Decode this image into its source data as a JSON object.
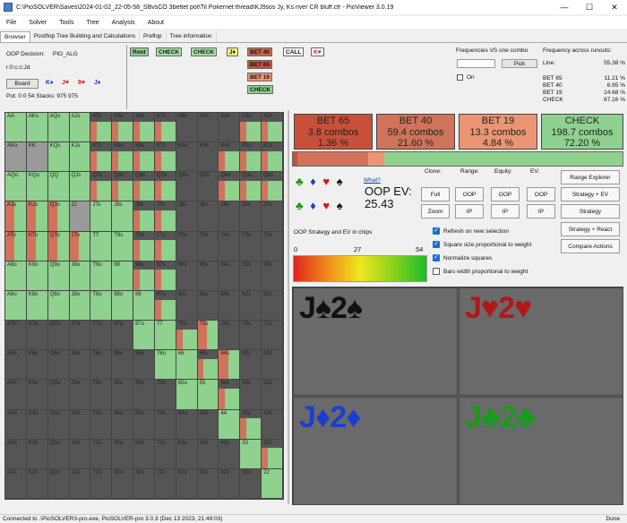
{
  "window": {
    "title": "C:\\PioSOLVER\\Saves\\2024-01-02_22-05-58_SBvsCO 3bettet pot\\Til Pokernet thread\\KJ9sos Jy, Ks river CR bluff.cfr - PioViewer 3.0.19",
    "min_glyph": "—",
    "max_glyph": "☐",
    "close_glyph": "✕"
  },
  "menu": [
    "File",
    "Solver",
    "Tools",
    "Tree",
    "Analysis",
    "About"
  ],
  "tabs": [
    "Browser",
    "Postflop Tree Building and Calculations",
    "Preflop",
    "Tree information"
  ],
  "active_tab": 0,
  "decision": {
    "label": "OOP Decision:",
    "value": "PIO_ALG",
    "board_code": "r:0:c:c:Jd",
    "board_button": "Board",
    "cards": [
      {
        "text": "K♦",
        "color": "#1a3fcf"
      },
      {
        "text": "J♥",
        "color": "#d01818"
      },
      {
        "text": "9♥",
        "color": "#d01818"
      },
      {
        "text": "J♦",
        "color": "#1a3fcf"
      }
    ],
    "pot_text": "Pot: 0 0 54 Stacks: 975 975"
  },
  "tree_nodes": [
    {
      "label": "Root",
      "bg": "#8fd18f"
    },
    {
      "label": "CHECK",
      "bg": "#a5e0a5"
    },
    {
      "label": "CHECK",
      "bg": "#a5e0a5"
    },
    {
      "label": "J♦",
      "bg": "#f5f07a"
    },
    {
      "label": "BET 40",
      "bg": "#c86a4e"
    },
    {
      "label": "CALL",
      "bg": "#ffffff"
    },
    {
      "label": "K♥",
      "bg": "#ffffff"
    },
    {
      "label": "BET 65",
      "bg": "#c8503a"
    },
    {
      "label": "BET 19",
      "bg": "#eb9575"
    },
    {
      "label": "CHECK",
      "bg": "#8fd18f"
    }
  ],
  "freq_combo": {
    "title": "Frequencies VS one combo",
    "pick": "Pick",
    "on_label": "On"
  },
  "runouts": {
    "title": "Frequency across runouts:",
    "line_label": "Line:",
    "line_value": "55.38 %",
    "rows": [
      {
        "label": "BET 65",
        "value": "11.21 %"
      },
      {
        "label": "BET 40",
        "value": "6.95 %"
      },
      {
        "label": "BET 19",
        "value": "14.68 %"
      },
      {
        "label": "CHECK",
        "value": "67.16 %"
      }
    ]
  },
  "actions": [
    {
      "name": "BET 65",
      "combos": "3.8 combos",
      "pct": "1.36 %",
      "color": "#c8503a",
      "share": 1.36
    },
    {
      "name": "BET 40",
      "combos": "59.4 combos",
      "pct": "21.60 %",
      "color": "#d0735a",
      "share": 21.6
    },
    {
      "name": "BET 19",
      "combos": "13.3 combos",
      "pct": "4.84 %",
      "color": "#eb9575",
      "share": 4.84
    },
    {
      "name": "CHECK",
      "combos": "198.7 combos",
      "pct": "72.20 %",
      "color": "#8fd18f",
      "share": 72.2
    }
  ],
  "suits_top": [
    {
      "s": "♣",
      "c": "#1a9a1a"
    },
    {
      "s": "♦",
      "c": "#1a3fcf"
    },
    {
      "s": "♥",
      "c": "#d01818"
    },
    {
      "s": "♠",
      "c": "#111111"
    }
  ],
  "suits_bottom": [
    {
      "s": "♣",
      "c": "#1a9a1a"
    },
    {
      "s": "♦",
      "c": "#1a3fcf"
    },
    {
      "s": "♥",
      "c": "#d01818"
    },
    {
      "s": "♠",
      "c": "#111111"
    }
  ],
  "ev": {
    "what": "What?",
    "label": "OOP EV:",
    "value": "25.43"
  },
  "headers": {
    "clone": "Clone:",
    "range": "Range:",
    "equity": "Equity:",
    "ev": "EV:"
  },
  "buttons": {
    "full": "Full",
    "zoom": "Zoom",
    "range_oop": "OOP",
    "range_ip": "IP",
    "equity_oop": "OOP",
    "equity_ip": "IP",
    "ev_oop": "OOP",
    "ev_ip": "IP",
    "range_explorer": "Range Explorer",
    "strategy_ev": "Strategy + EV",
    "strategy": "Strategy",
    "strategy_react": "Strategy + React",
    "compare_actions": "Compare Actions"
  },
  "chips": {
    "label": "OOP Strategy and EV in chips",
    "min": "0",
    "mid": "27",
    "max": "54"
  },
  "checkboxes": [
    {
      "label": "Refresh on new selection",
      "on": true
    },
    {
      "label": "Square size proportional to weight",
      "on": true
    },
    {
      "label": "Normalize squares",
      "on": true
    },
    {
      "label": "Bars width proportional to weight",
      "on": false
    }
  ],
  "combos": [
    {
      "rank1": "J",
      "s1": "♠",
      "rank2": "2",
      "s2": "♠",
      "color": "#111111"
    },
    {
      "rank1": "J",
      "s1": "♥",
      "rank2": "2",
      "s2": "♥",
      "color": "#b01818"
    },
    {
      "rank1": "J",
      "s1": "♦",
      "rank2": "2",
      "s2": "♦",
      "color": "#1a3fcf"
    },
    {
      "rank1": "J",
      "s1": "♣",
      "rank2": "2",
      "s2": "♣",
      "color": "#1a9a1a"
    }
  ],
  "status": {
    "left": "Connected to .\\PioSOLVER3-pro.exe, PioSOLVER-pro 3.0.3 (Dec 13 2023, 21:49:03)",
    "right": "Done"
  },
  "grid": {
    "ranks": [
      "A",
      "K",
      "Q",
      "J",
      "T",
      "9",
      "8",
      "7",
      "6",
      "5",
      "4",
      "3",
      "2"
    ],
    "colors": {
      "check": "#8fd18f",
      "bet19": "#eb9575",
      "bet40": "#d0735a",
      "bet65": "#c8503a",
      "empty": "#555555",
      "blocked": "#9a9a9a"
    },
    "cells": [
      [
        "G",
        "G",
        "G",
        "G",
        "M",
        "M",
        "M",
        "M",
        "E",
        "E",
        "E",
        "M",
        "M"
      ],
      [
        "B",
        "B",
        "G",
        "G",
        "M",
        "M",
        "M",
        "M",
        "E",
        "E",
        "M",
        "M",
        "M"
      ],
      [
        "G",
        "G",
        "G",
        "G",
        "M",
        "M",
        "M",
        "M",
        "E",
        "E",
        "M",
        "M",
        "M"
      ],
      [
        "R",
        "R",
        "R",
        "B",
        "G",
        "G",
        "M",
        "M",
        "E",
        "E",
        "E",
        "E",
        "E"
      ],
      [
        "R",
        "R",
        "R",
        "R",
        "G",
        "G",
        "M",
        "M",
        "E",
        "E",
        "E",
        "E",
        "E"
      ],
      [
        "G",
        "G",
        "G",
        "G",
        "G",
        "G",
        "M",
        "M",
        "E",
        "E",
        "E",
        "E",
        "E"
      ],
      [
        "G",
        "G",
        "G",
        "G",
        "G",
        "G",
        "G",
        "M",
        "E",
        "E",
        "E",
        "E",
        "E"
      ],
      [
        "E",
        "E",
        "E",
        "E",
        "E",
        "E",
        "G",
        "G",
        "M",
        "R",
        "E",
        "E",
        "E"
      ],
      [
        "E",
        "E",
        "E",
        "E",
        "E",
        "E",
        "E",
        "G",
        "G",
        "M",
        "R",
        "E",
        "E"
      ],
      [
        "E",
        "E",
        "E",
        "E",
        "E",
        "E",
        "E",
        "E",
        "G",
        "G",
        "M",
        "E",
        "E"
      ],
      [
        "E",
        "E",
        "E",
        "E",
        "E",
        "E",
        "E",
        "E",
        "E",
        "E",
        "G",
        "M",
        "E"
      ],
      [
        "E",
        "E",
        "E",
        "E",
        "E",
        "E",
        "E",
        "E",
        "E",
        "E",
        "E",
        "G",
        "M"
      ],
      [
        "E",
        "E",
        "E",
        "E",
        "E",
        "E",
        "E",
        "E",
        "E",
        "E",
        "E",
        "E",
        "G"
      ]
    ]
  }
}
